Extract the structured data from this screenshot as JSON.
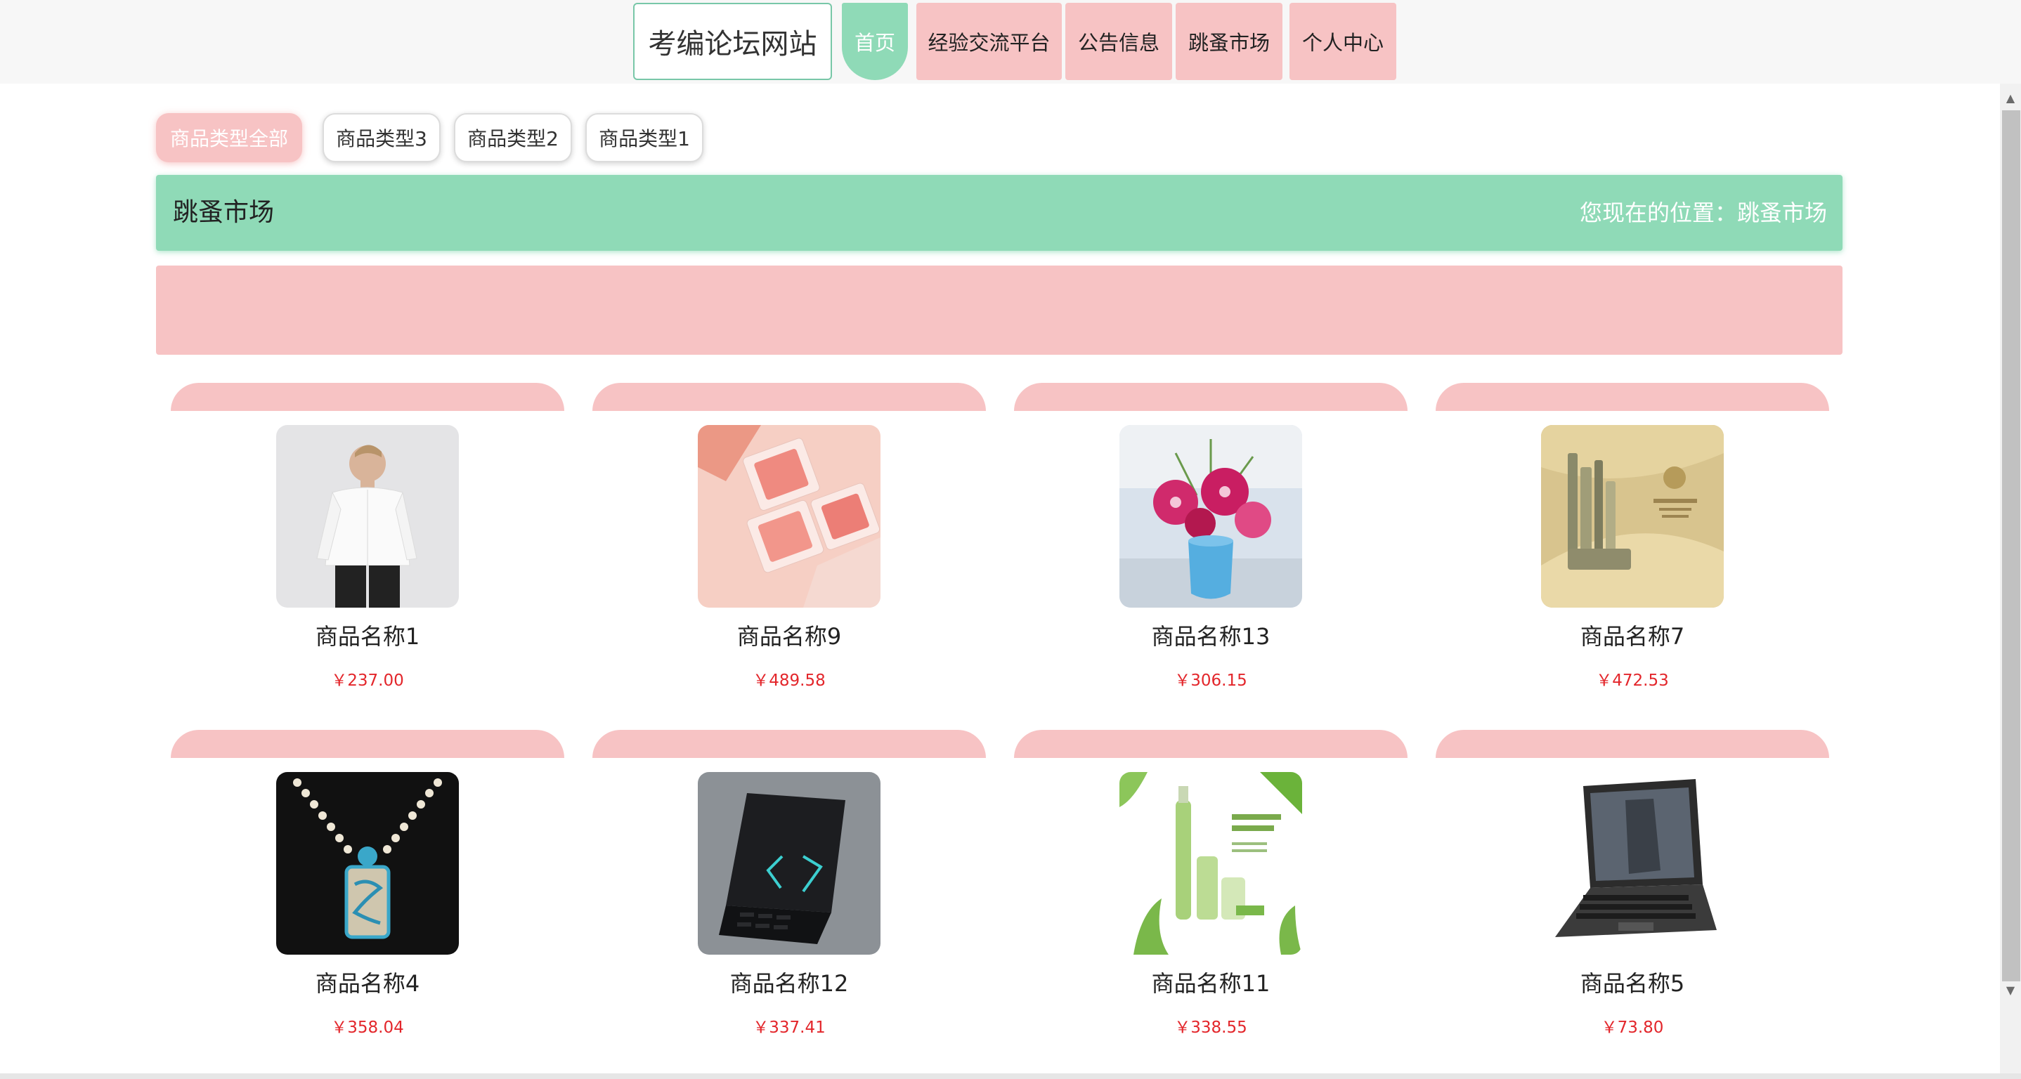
{
  "header": {
    "site_title": "考编论坛网站",
    "nav": [
      {
        "label": "首页",
        "active": true
      },
      {
        "label": "经验交流平台",
        "active": false
      },
      {
        "label": "公告信息",
        "active": false
      },
      {
        "label": "跳蚤市场",
        "active": false
      },
      {
        "label": "个人中心",
        "active": false
      }
    ]
  },
  "filters": [
    {
      "label": "商品类型全部",
      "active": true
    },
    {
      "label": "商品类型3",
      "active": false
    },
    {
      "label": "商品类型2",
      "active": false
    },
    {
      "label": "商品类型1",
      "active": false
    }
  ],
  "section": {
    "title": "跳蚤市场",
    "breadcrumb": "您现在的位置：跳蚤市场"
  },
  "products": [
    {
      "name": "商品名称1",
      "price": "￥237.00",
      "image": "shirt-model-photo"
    },
    {
      "name": "商品名称9",
      "price": "￥489.58",
      "image": "blush-palette-photo"
    },
    {
      "name": "商品名称13",
      "price": "￥306.15",
      "image": "lily-bouquet-photo"
    },
    {
      "name": "商品名称7",
      "price": "￥472.53",
      "image": "skincare-set-photo"
    },
    {
      "name": "商品名称4",
      "price": "￥358.04",
      "image": "jade-pendant-photo"
    },
    {
      "name": "商品名称12",
      "price": "￥337.41",
      "image": "gaming-laptop-photo"
    },
    {
      "name": "商品名称11",
      "price": "￥338.55",
      "image": "green-cosmetics-photo"
    },
    {
      "name": "商品名称5",
      "price": "￥73.80",
      "image": "rugged-laptop-photo"
    }
  ],
  "colors": {
    "accent_green": "#8fdab7",
    "accent_pink": "#f7c3c4",
    "price_red": "#e3262b"
  }
}
